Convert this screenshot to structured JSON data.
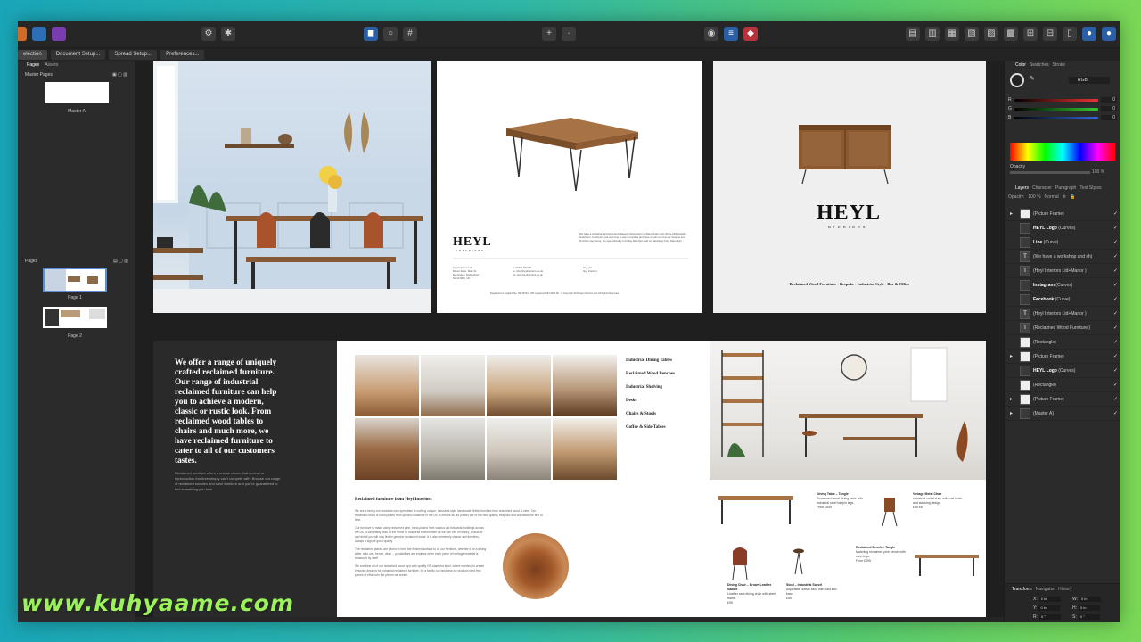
{
  "context_bar": {
    "items": [
      "election",
      "Document Setup...",
      "Spread Setup...",
      "Preferences..."
    ]
  },
  "left_panel": {
    "tabs": [
      "Pages",
      "Assets"
    ],
    "master_section": "Master Pages",
    "master_label": "Master A",
    "pages_section": "Pages",
    "pages": [
      {
        "label": "Page 1"
      },
      {
        "label": "Page 2"
      }
    ]
  },
  "right_panel": {
    "color_tabs": [
      "Color",
      "Swatches",
      "Stroke"
    ],
    "color_model": "RGB",
    "sliders": [
      {
        "label": "R",
        "value": "0",
        "color": "#d33"
      },
      {
        "label": "G",
        "value": "0",
        "color": "#3a3"
      },
      {
        "label": "B",
        "value": "0",
        "color": "#35c"
      }
    ],
    "opacity_label": "Opacity",
    "opacity_value": "100 %",
    "layers_tabs": [
      "Layers",
      "Character",
      "Paragraph",
      "Text Styles"
    ],
    "layers_opacity_label": "Opacity:",
    "layers_opacity_value": "100 %",
    "blend_mode": "Normal",
    "layers": [
      {
        "name": "(Picture Frame)",
        "kind": "img"
      },
      {
        "name": "HEYL Logo",
        "suffix": " (Curves)",
        "kind": "dark"
      },
      {
        "name": "Line",
        "suffix": " (Curve)",
        "kind": "dark"
      },
      {
        "name": "(We have a workshop and sh)",
        "kind": "text"
      },
      {
        "name": "(Heyl Interiors Ltd+Manor )",
        "kind": "text"
      },
      {
        "name": "Instagram",
        "suffix": " (Curves)",
        "kind": "dark"
      },
      {
        "name": "Facebook",
        "suffix": " (Curve)",
        "kind": "dark"
      },
      {
        "name": "(Heyl Interiors Ltd+Manor )",
        "kind": "text"
      },
      {
        "name": "(Reclaimed Wood Furniture )",
        "kind": "text"
      },
      {
        "name": "(Rectangle)",
        "kind": "white"
      },
      {
        "name": "(Picture Frame)",
        "kind": "img"
      },
      {
        "name": "HEYL Logo",
        "suffix": " (Curves)",
        "kind": "dark"
      },
      {
        "name": "(Rectangle)",
        "kind": "white"
      },
      {
        "name": "(Picture Frame)",
        "kind": "img"
      },
      {
        "name": "(Master A)",
        "kind": "dark"
      }
    ],
    "transform_tabs": [
      "Transform",
      "Navigator",
      "History"
    ],
    "transform_fields": [
      {
        "label": "X:",
        "value": "0 in"
      },
      {
        "label": "W:",
        "value": "0 in"
      },
      {
        "label": "Y:",
        "value": "0 in"
      },
      {
        "label": "H:",
        "value": "0 in"
      },
      {
        "label": "R:",
        "value": "0 °"
      },
      {
        "label": "S:",
        "value": "0 °"
      }
    ]
  },
  "spread1": {
    "logo": "HEYL",
    "logo_sub": "INTERIORS",
    "p2_address": "Heyl Interiors Ltd\nManor Farm, Main St\nEverington, Nottingham\nNG13 9DQ, UK",
    "p2_contact": "t: 07949 662740\ne: info@heylinteriors.co.uk\nw: www.heylinteriors.co.uk",
    "p2_social": "heyl_ltd\nheyl interiors",
    "p2_workshop": "We have a workshop and showroom based in Everington at Manor Farm just off the A52 towards Grantham. Customers are welcome to pop in anytime and have a look round at our designs and find their way home, the open Monday to Friday 9am-5pm and on Saturdays from 10am-1pm.",
    "p2_footer": "Registered in England No. 09879794 · VAT registered 251 9283 84 · © Copyright 2019 Heyl Interiors Ltd. All Rights Reserved.",
    "p3_tagline": "Reclaimed Wood Furniture · Bespoke · Industrial Style · Bar & Office"
  },
  "spread2": {
    "heading": "We offer a range of uniquely crafted reclaimed furniture. Our range of industrial reclaimed furniture can help you to achieve a modern, classic or rustic look. From reclaimed wood tables to chairs and much more, we have reclaimed furniture to cater to all of our customers tastes.",
    "body": "Reclaimed furniture offers a unique charm that normal or reproduction furniture simply can't compete with. Browse our range of reclaimed wooden and steel furniture and you're guaranteed to find something you love.",
    "categories": [
      "Industrial Dining Tables",
      "Reclaimed Wood Benches",
      "Industrial Shelving",
      "Desks",
      "Chairs & Stools",
      "Coffee & Side Tables"
    ],
    "text_heading": "Reclaimed furniture from Heyl Interiors",
    "paragraphs": [
      "We are a family-run business who specialise in crafting unique, industrial-style handmade British furniture from reclaimed wood & steel. Our reclaimed wood is hand picked from specific locations in the UK to ensure all our pieces are of the best quality, bespoke and will stand the test of time.",
      "Our furniture is made using reclaimed pine, hand-picked from various old industrial buildings across the UK. It can easily work in the home or business environment as we can mix of history, character and detail you will only find in genuine reclaimed wood. It is also extremely classic and timeless, always a sign of good quality.",
      "The reclaimed planks are joined to form the finished surface to all our furniture, whether it be a dining table, side unit, bench, desk ... possibilities are endless when each piece of heritage material is treasured by itself.",
      "We combine all of our reclaimed wood tops with quality GR-stamped steel, where needed, to create bespoke designs for industrial reclaimed furniture, for a family-run business we produce dent-free pieces of effort into the pieces we create."
    ],
    "products": [
      {
        "title": "Dining Table – Tangle",
        "desc": "Reclaimed wood dining table with industrial steel hairpin legs.",
        "price": "From £695"
      },
      {
        "title": "Vintage Metal Chair",
        "desc": "Industrial metal chair with rust finish and stacking design.",
        "price": "£85 ea"
      },
      {
        "title": "Dining Chair – Brown Leather Saddle",
        "desc": "Leather seat dining chair with steel frame.",
        "price": "£95"
      },
      {
        "title": "Stool – Industrial Swivel",
        "desc": "Adjustable swivel stool with cast iron base.",
        "price": "£55"
      },
      {
        "title": "Reclaimed Bench – Tangle",
        "desc": "Matching reclaimed pine bench with steel legs.",
        "price": "From £295"
      }
    ]
  },
  "watermark": "www.kuhyaame.com"
}
